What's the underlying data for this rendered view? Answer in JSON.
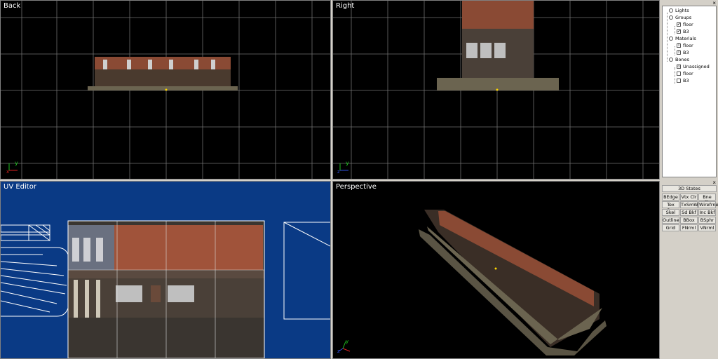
{
  "viewports": {
    "back": {
      "title": "Back"
    },
    "right": {
      "title": "Right"
    },
    "uv": {
      "title": "UV Editor"
    },
    "perspective": {
      "title": "Perspective"
    }
  },
  "axis": {
    "x": "x",
    "y": "y",
    "z": "z"
  },
  "tree": {
    "items": [
      {
        "label": "Lights",
        "icon": "light-icon"
      },
      {
        "label": "Groups",
        "icon": "group-icon"
      },
      {
        "label": "floor",
        "icon": "checkbox-icon",
        "checked": "✔"
      },
      {
        "label": "B3",
        "icon": "checkbox-icon",
        "checked": "✔"
      },
      {
        "label": "Materials",
        "icon": "material-icon"
      },
      {
        "label": "floor",
        "icon": "texture-icon",
        "checked": "T"
      },
      {
        "label": "B3",
        "icon": "texture-icon",
        "checked": "T"
      },
      {
        "label": "Bones",
        "icon": "bones-icon"
      },
      {
        "label": "Unassigned",
        "icon": "checkbox-icon",
        "checked": "▫"
      },
      {
        "label": "floor",
        "icon": "checkbox-icon",
        "checked": ""
      },
      {
        "label": "B3",
        "icon": "checkbox-icon",
        "checked": ""
      }
    ]
  },
  "states": {
    "title": "3D States",
    "buttons": [
      "BEdge",
      "Vtx Clr",
      "Bne Clr",
      "Tex Srn",
      "TxSmWr",
      "Wirefrne",
      "Skel",
      "Sd Bkf",
      "Inc Bkf",
      "Outline",
      "BBox",
      "BSphr",
      "Grid",
      "FNrml",
      "VNrml"
    ]
  },
  "close_glyph": "×",
  "colors": {
    "uv_bg": "#0a3a85",
    "grid": "#8a8a8a",
    "brick": "#a0533a"
  }
}
